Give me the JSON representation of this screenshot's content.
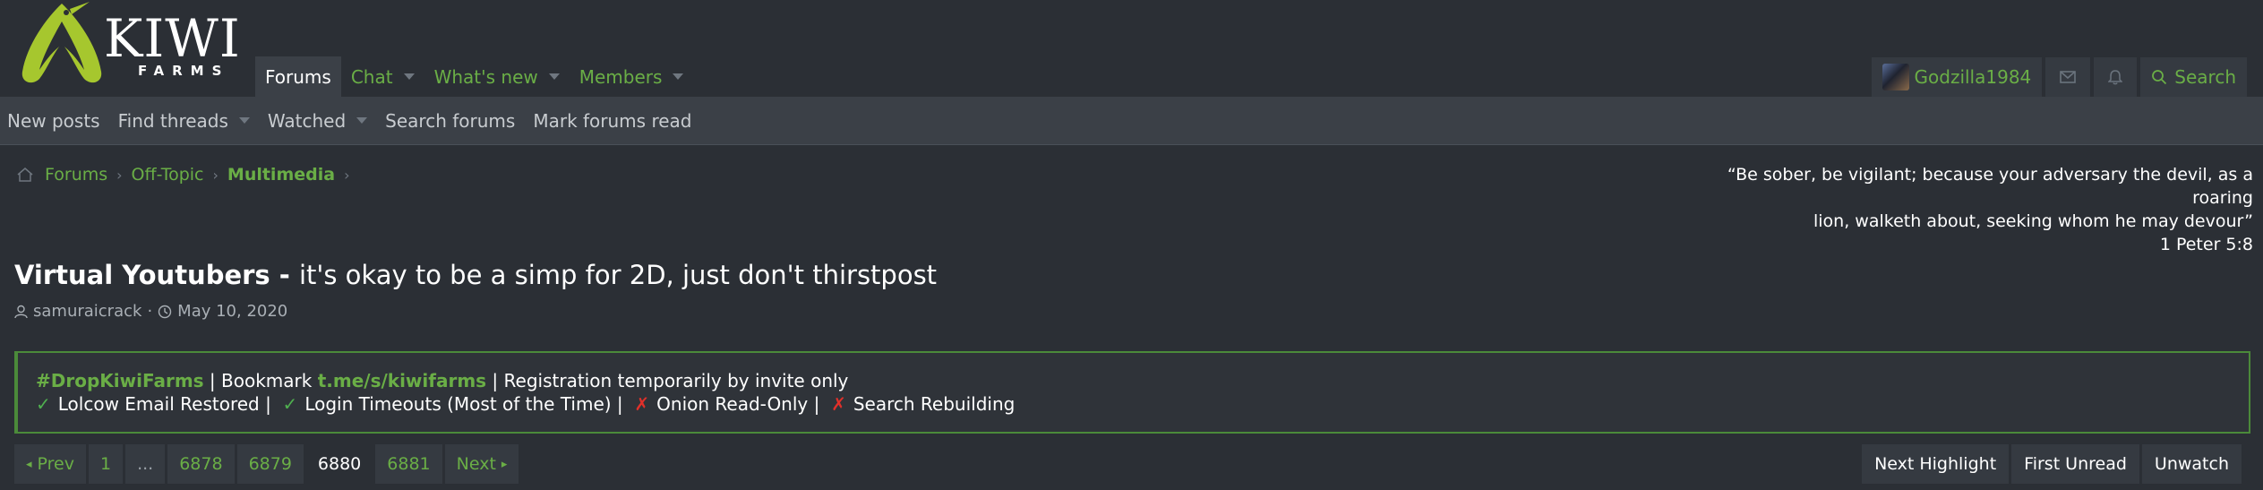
{
  "brand": {
    "name_big": "KIWI",
    "name_small": "FARMS",
    "accent": "#6aae46",
    "logo_color": "#a6c72e"
  },
  "nav": {
    "tabs": [
      {
        "label": "Forums",
        "active": true
      },
      {
        "label": "Chat",
        "dropdown": true
      },
      {
        "label": "What's new",
        "dropdown": true
      },
      {
        "label": "Members",
        "dropdown": true
      }
    ]
  },
  "user": {
    "name": "Godzilla1984",
    "search_label": "Search",
    "icons": [
      "envelope-icon",
      "bell-icon",
      "search-icon"
    ]
  },
  "subnav": {
    "items": [
      {
        "label": "New posts"
      },
      {
        "label": "Find threads",
        "dropdown": true
      },
      {
        "label": "Watched",
        "dropdown": true
      },
      {
        "label": "Search forums"
      },
      {
        "label": "Mark forums read"
      }
    ]
  },
  "breadcrumb": {
    "items": [
      "Forums",
      "Off-Topic",
      "Multimedia"
    ]
  },
  "quote": {
    "line1": "“Be sober, be vigilant; because your adversary the devil, as a roaring",
    "line2": "lion, walketh about, seeking whom he may devour”",
    "ref": "1 Peter 5:8"
  },
  "thread": {
    "prefix": "Virtual Youtubers - ",
    "title": "it's okay to be a simp for 2D, just don't thirstpost",
    "author": "samuraicrack",
    "date": "May 10, 2020"
  },
  "notice": {
    "tag": "#DropKiwiFarms",
    "bookmark_text": " | Bookmark ",
    "bookmark_link": "t.me/s/kiwifarms",
    "registration": " | Registration temporarily by invite only",
    "statuses": [
      {
        "ok": true,
        "text": "Lolcow Email Restored |"
      },
      {
        "ok": true,
        "text": "Login Timeouts (Most of the Time) |"
      },
      {
        "ok": false,
        "text": "Onion Read-Only |"
      },
      {
        "ok": false,
        "text": "Search Rebuilding"
      }
    ]
  },
  "pagination": {
    "prev": "Prev",
    "pages": [
      "1",
      "...",
      "6878",
      "6879",
      "6880",
      "6881"
    ],
    "current": "6880",
    "next": "Next"
  },
  "thread_actions": [
    "Next Highlight",
    "First Unread",
    "Unwatch"
  ]
}
